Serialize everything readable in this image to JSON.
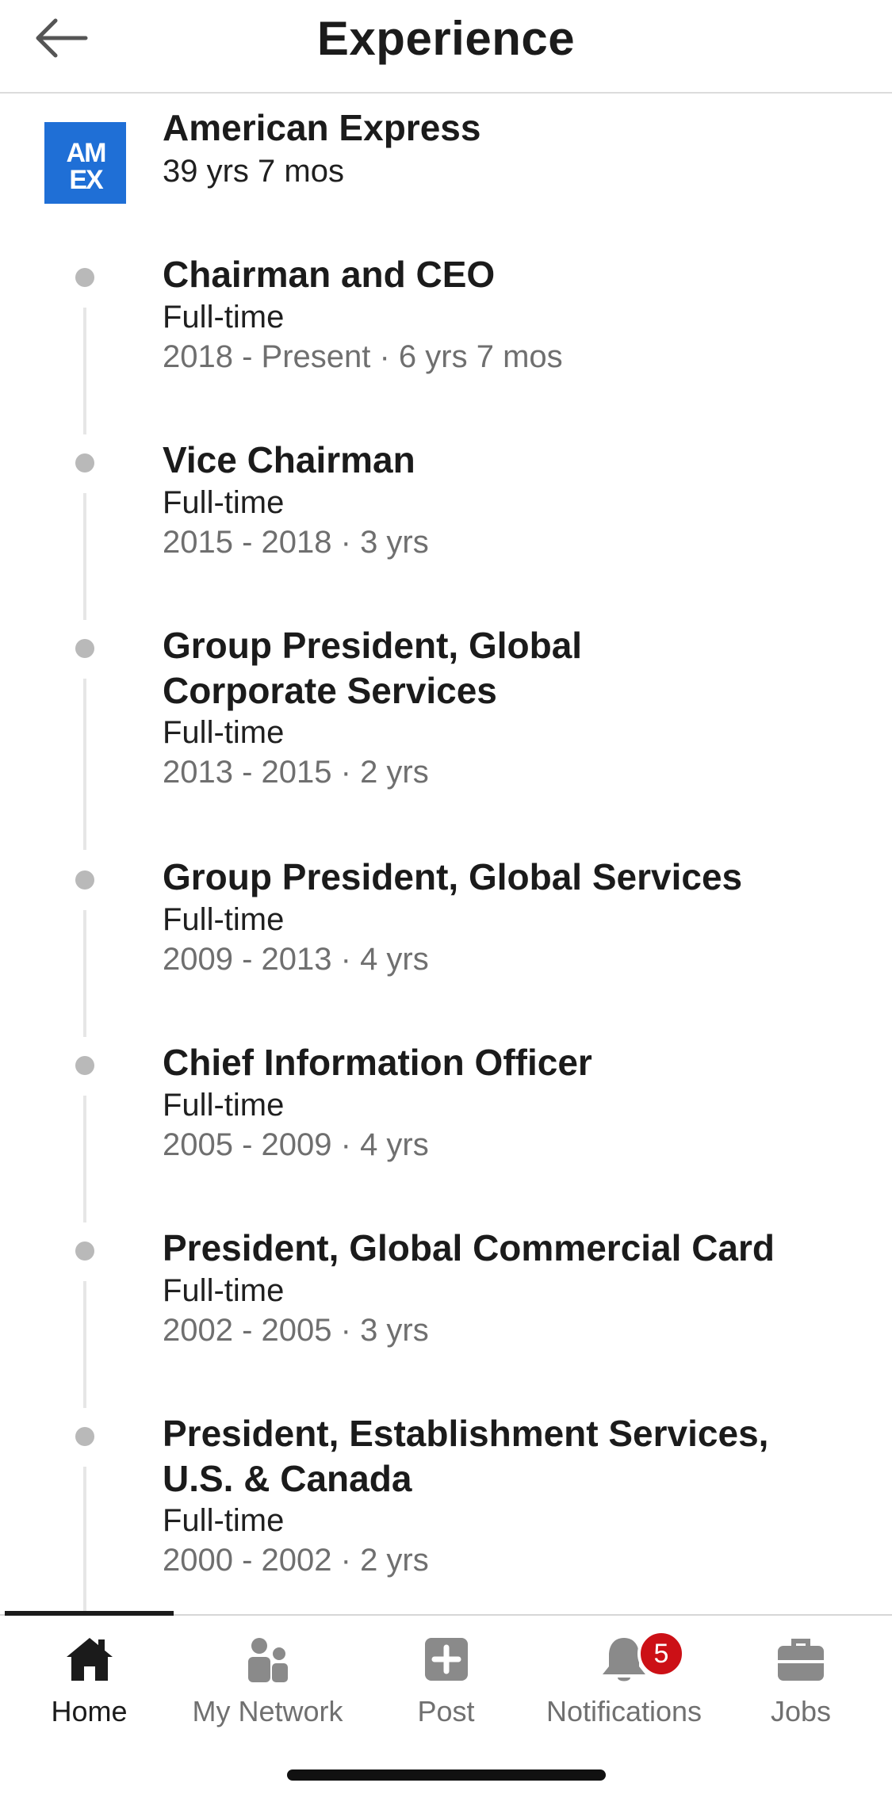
{
  "header": {
    "title": "Experience"
  },
  "company": {
    "name": "American Express",
    "tenure": "39 yrs 7 mos",
    "logo_text": "AMEX",
    "logo_color": "#1f6fd6"
  },
  "roles": [
    {
      "title": "Chairman and CEO",
      "type": "Full-time",
      "dates": "2018 - Present · 6 yrs 7 mos"
    },
    {
      "title": "Vice Chairman",
      "type": "Full-time",
      "dates": "2015 - 2018 · 3 yrs"
    },
    {
      "title": "Group President, Global Corporate Services",
      "type": "Full-time",
      "dates": "2013 - 2015 · 2 yrs"
    },
    {
      "title": "Group President, Global Services",
      "type": "Full-time",
      "dates": "2009 - 2013 · 4 yrs"
    },
    {
      "title": "Chief Information Officer",
      "type": "Full-time",
      "dates": "2005 - 2009 · 4 yrs"
    },
    {
      "title": "President, Global Commercial Card",
      "type": "Full-time",
      "dates": "2002 - 2005 · 3 yrs"
    },
    {
      "title": "President, Establishment Services, U.S. & Canada",
      "type": "Full-time",
      "dates": "2000 - 2002 · 2 yrs"
    }
  ],
  "tabbar": {
    "active": "Home",
    "tabs": [
      {
        "label": "Home",
        "icon": "home-icon"
      },
      {
        "label": "My Network",
        "icon": "network-icon"
      },
      {
        "label": "Post",
        "icon": "post-icon"
      },
      {
        "label": "Notifications",
        "icon": "bell-icon",
        "badge": "5"
      },
      {
        "label": "Jobs",
        "icon": "briefcase-icon"
      }
    ],
    "badge_color": "#cc1016"
  }
}
